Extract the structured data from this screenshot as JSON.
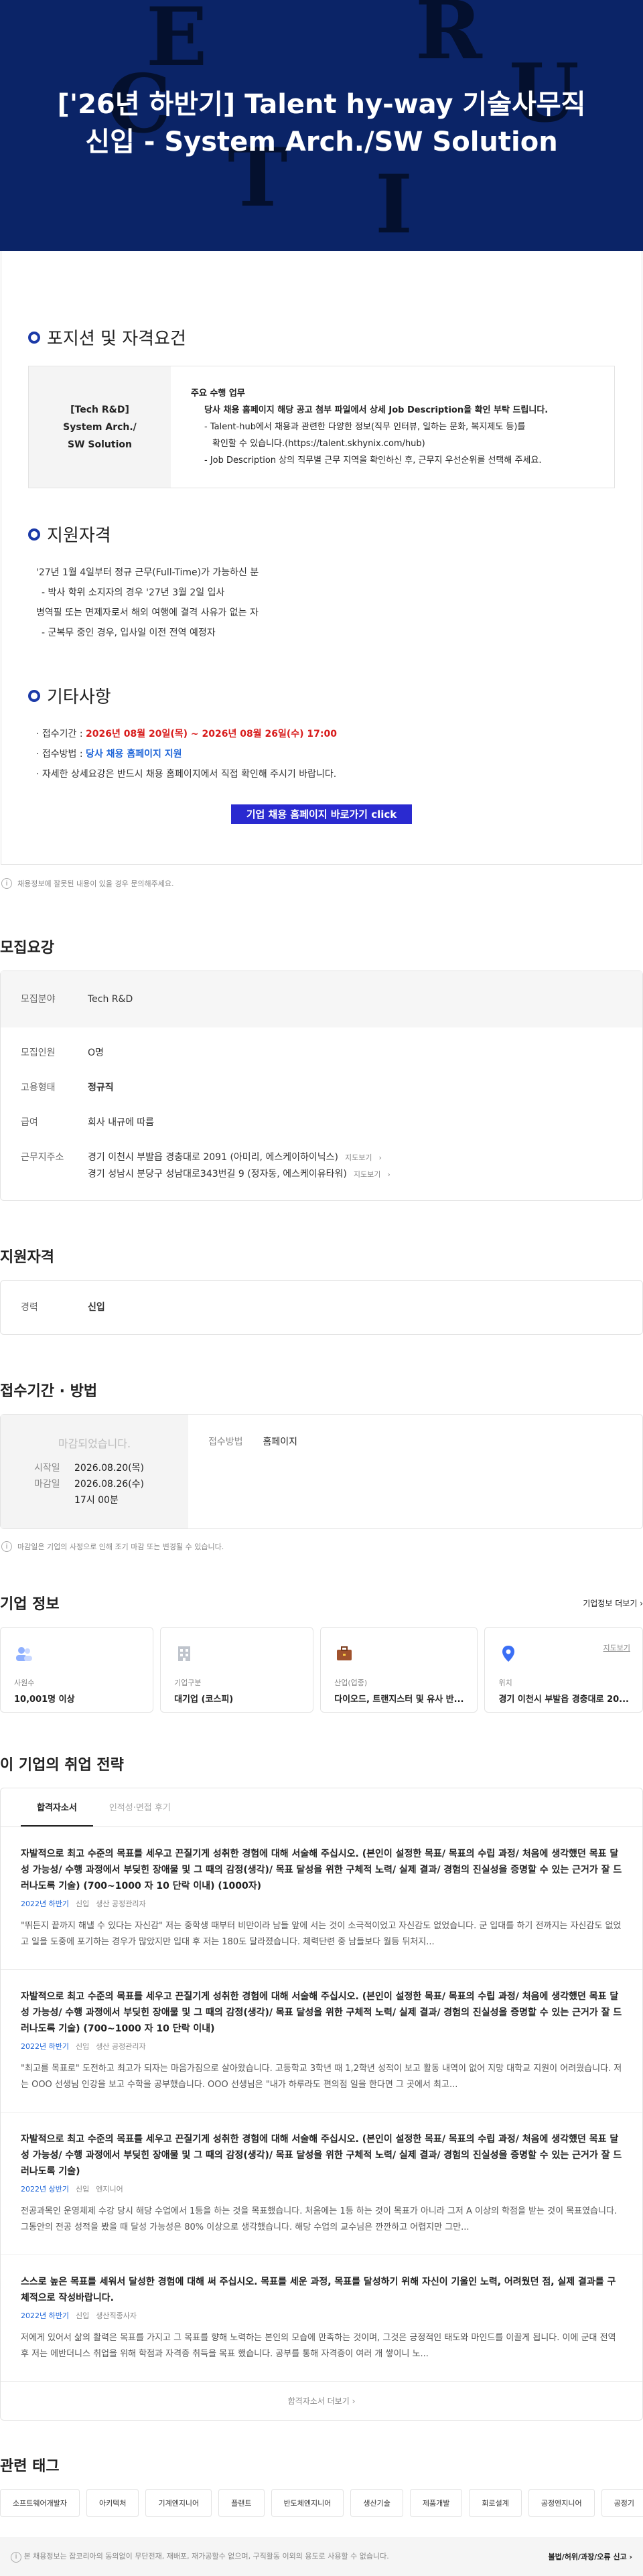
{
  "hero": {
    "letters": [
      "E",
      "R",
      "C",
      "U",
      "T",
      "I"
    ],
    "title_line1": "['26년 하반기] Talent hy-way 기술사무직",
    "title_line2": "신입 - System Arch./SW Solution"
  },
  "position": {
    "heading": "포지션 및 자격요건",
    "left_line1": "[Tech R&D]",
    "left_line2": "System Arch./",
    "left_line3": "SW Solution",
    "right_title": "주요 수행 업무",
    "right_lines": [
      "당사 채용 홈페이지 해당 공고 첨부 파일에서 상세 Job Description을 확인 부탁 드립니다.",
      "- Talent-hub에서 채용과 관련한 다양한 정보(직무 인터뷰, 일하는 문화, 복지제도 등)를",
      "확인할 수 있습니다.(https://talent.skhynix.com/hub)",
      "- Job Description 상의 직무별 근무 지역을 확인하신 후, 근무지 우선순위를 선택해 주세요."
    ]
  },
  "qualification": {
    "heading": "지원자격",
    "items": [
      "'27년 1월 4일부터 정규 근무(Full-Time)가 가능하신 분",
      "- 박사 학위 소지자의 경우 '27년 3월 2일 입사",
      "병역필 또는 면제자로서 해외 여행에 결격 사유가 없는 자",
      "- 군복무 중인 경우, 입사일 이전 전역 예정자"
    ]
  },
  "etc": {
    "heading": "기타사항",
    "period_label": "· 접수기간 : ",
    "period_value": "2026년 08월 20일(목) ~ 2026년 08월 26일(수) 17:00",
    "method_label": "· 접수방법 : ",
    "method_value": "당사 채용 홈페이지 지원",
    "note": "· 자세한 상세요강은 반드시 채용 홈페이지에서 직접 확인해 주시기 바랍니다.",
    "cta": "기업 채용 홈페이지 바로가기 click"
  },
  "notice_text": "채용정보에 잘못된 내용이 있을 경우 문의해주세요.",
  "summary": {
    "heading": "모집요강",
    "field_label": "모집분야",
    "field_value": "Tech R&D",
    "count_label": "모집인원",
    "count_value": "O명",
    "type_label": "고용형태",
    "type_value": "정규직",
    "salary_label": "급여",
    "salary_value": "회사 내규에 따름",
    "address_label": "근무지주소",
    "address1": "경기 이천시 부발읍 경충대로 2091 (아미리, 에스케이하이닉스)",
    "address2": "경기 성남시 분당구 성남대로343번길 9 (정자동, 에스케이유타워)",
    "map_link": "지도보기"
  },
  "eligibility": {
    "heading": "지원자격",
    "label": "경력",
    "value": "신입"
  },
  "apply": {
    "heading": "접수기간 · 방법",
    "closed": "마감되었습니다.",
    "start_label": "시작일",
    "start_value": "2026.08.20(목)",
    "end_label": "마감일",
    "end_value": "2026.08.26(수)",
    "end_time": "17시 00분",
    "method_label": "접수방법",
    "method_value": "홈페이지",
    "notice": "마감일은 기업의 사정으로 인해 조기 마감 또는 변경될 수 있습니다."
  },
  "company": {
    "heading": "기업 정보",
    "more": "기업정보 더보기",
    "cards": [
      {
        "label": "사원수",
        "value": "10,001명 이상",
        "icon": "people-icon"
      },
      {
        "label": "기업구분",
        "value": "대기업 (코스피)",
        "icon": "building-icon"
      },
      {
        "label": "산업(업종)",
        "value": "다이오드, 트랜지스터 및 유사 반...",
        "icon": "briefcase-icon"
      },
      {
        "label": "위치",
        "value": "경기 이천시 부발읍 경충대로 20...",
        "icon": "map-pin-icon",
        "link": "지도보기"
      }
    ]
  },
  "strategy": {
    "heading": "이 기업의 취업 전략",
    "tabs": [
      "합격자소서",
      "인적성·면접 후기"
    ],
    "essays": [
      {
        "q": "자발적으로 최고 수준의 목표를 세우고 끈질기게 성취한 경험에 대해 서술해 주십시오. (본인이 설정한 목표/ 목표의 수립 과정/ 처음에 생각했던 목표 달성 가능성/ 수행 과정에서 부딪힌 장애물 및 그 때의 감정(생각)/ 목표 달성을 위한 구체적 노력/ 실제 결과/ 경험의 진실성을 증명할 수 있는 근거가 잘 드러나도록 기술) (700~1000 자 10 단락 이내) (1000자)",
        "year": "2022년 하반기",
        "m1": "신입",
        "m2": "생산 공정관리자",
        "a": "\"뛰든지 끝까지 해낼 수 있다는 자신감\" 저는 중학생 때부터 비만이라 남들 앞에 서는 것이 소극적이었고 자신감도 없었습니다. 군 입대를 하기 전까지는 자신감도 없었고 일을 도중에 포기하는 경우가 많았지만 입대 후 저는 180도 달라졌습니다. 체력단련 중 남들보다 월등 뒤처지..."
      },
      {
        "q": "자발적으로 최고 수준의 목표를 세우고 끈질기게 성취한 경험에 대해 서술해 주십시오. (본인이 설정한 목표/ 목표의 수립 과정/ 처음에 생각했던 목표 달성 가능성/ 수행 과정에서 부딪힌 장애물 및 그 때의 감정(생각)/ 목표 달성을 위한 구체적 노력/ 실제 결과/ 경험의 진실성을 증명할 수 있는 근거가 잘 드러나도록 기술) (700~1000 자 10 단락 이내)",
        "year": "2022년 하반기",
        "m1": "신입",
        "m2": "생산 공정관리자",
        "a": "\"최고를 목표로\" 도전하고 최고가 되자는 마음가짐으로 살아왔습니다. 고등학교 3학년 때 1,2학년 성적이 보고 활동 내역이 없어 지망 대학교 지원이 어려웠습니다. 저는 OOO 선생님 인강을 보고 수학을 공부했습니다. OOO 선생님은 \"내가 하루라도 편의점 일을 한다면 그 곳에서 최고..."
      },
      {
        "q": "자발적으로 최고 수준의 목표를 세우고 끈질기게 성취한 경험에 대해 서술해 주십시오. (본인이 설정한 목표/ 목표의 수립 과정/ 처음에 생각했던 목표 달성 가능성/ 수행 과정에서 부딪힌 장애물 및 그 때의 감정(생각)/ 목표 달성을 위한 구체적 노력/ 실제 결과/ 경험의 진실성을 증명할 수 있는 근거가 잘 드러나도록 기술)",
        "year": "2022년 상반기",
        "m1": "신입",
        "m2": "엔지니어",
        "a": "전공과목인 운영체제 수강 당시 해당 수업에서 1등을 하는 것을 목표했습니다. 처음에는 1등 하는 것이 목표가 아니라 그저 A 이상의 학점을 받는 것이 목표였습니다. 그동안의 전공 성적을 봤을 때 달성 가능성은 80% 이상으로 생각했습니다. 해당 수업의 교수님은 깐깐하고 어렵지만 그만..."
      },
      {
        "q": "스스로 높은 목표를 세워서 달성한 경험에 대해 써 주십시오. 목표를 세운 과정, 목표를 달성하기 위해 자신이 기울인 노력, 어려웠던 점, 실제 결과를 구체적으로 작성바랍니다.",
        "year": "2022년 하반기",
        "m1": "신입",
        "m2": "생산직종사자",
        "a": "저에게 있어서 삶의 활력은 목표를 가지고 그 목표를 향해 노력하는 본인의 모습에 만족하는 것이며, 그것은 긍정적인 태도와 마인드를 이끌게 됩니다. 이에 군대 전역 후 저는 에반더니스 취업을 위해 학점과 자격증 취득을 목표 했습니다. 공부를 통해 자격증이 여러 개 쌓이니 노..."
      }
    ],
    "more": "합격자소서 더보기"
  },
  "tags": {
    "heading": "관련 태그",
    "items": [
      "소프트웨어개발자",
      "아키텍처",
      "기계엔지니어",
      "플랜트",
      "반도체엔지니어",
      "생산기술",
      "제품개발",
      "회로설계",
      "공정엔지니어",
      "공정기"
    ]
  },
  "footer": {
    "left": "본 채용정보는 잡코리아의 동의없이 무단전재, 재배포, 재가공할수 없으며, 구직활동 이외의 용도로 사용할 수 없습니다.",
    "right": "불법/허위/과장/오류 신고"
  },
  "colors": {
    "hero_bg": "#0b2467",
    "accent_blue": "#1c3aa8",
    "deadline_red": "#d81b1b",
    "link_blue": "#1c64d8",
    "cta_bg": "#2a2ad0"
  }
}
